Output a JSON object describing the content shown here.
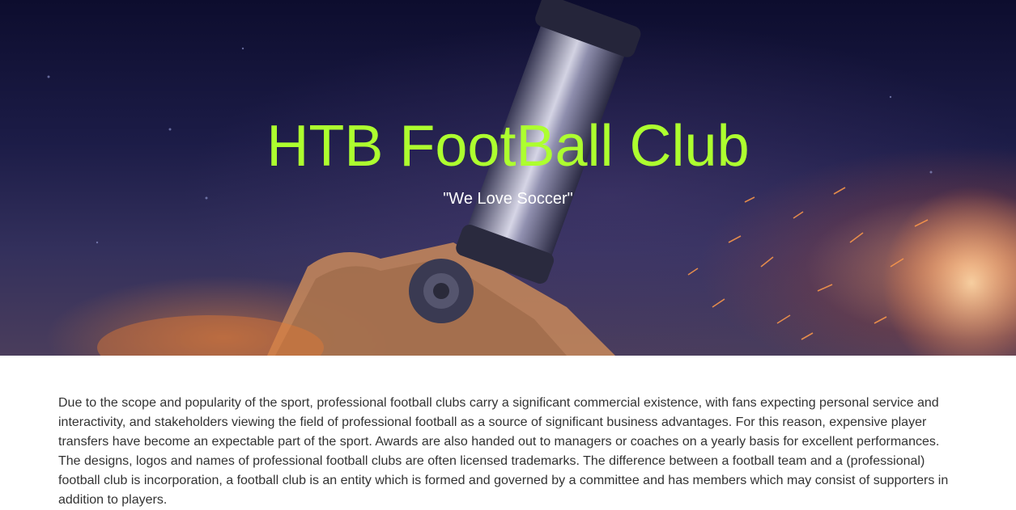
{
  "hero": {
    "title": "HTB FootBall Club",
    "subtitle": "\"We Love Soccer\"",
    "background_image": "football-boot-sparks-image"
  },
  "content": {
    "paragraph": "Due to the scope and popularity of the sport, professional football clubs carry a significant commercial existence, with fans expecting personal service and interactivity, and stakeholders viewing the field of professional football as a source of significant business advantages. For this reason, expensive player transfers have become an expectable part of the sport. Awards are also handed out to managers or coaches on a yearly basis for excellent performances. The designs, logos and names of professional football clubs are often licensed trademarks. The difference between a football team and a (professional) football club is incorporation, a football club is an entity which is formed and governed by a committee and has members which may consist of supporters in addition to players."
  },
  "colors": {
    "title": "#adff2f",
    "subtitle": "#ffffff",
    "body_text": "#333333",
    "hero_dark": "#0d0d2e"
  }
}
